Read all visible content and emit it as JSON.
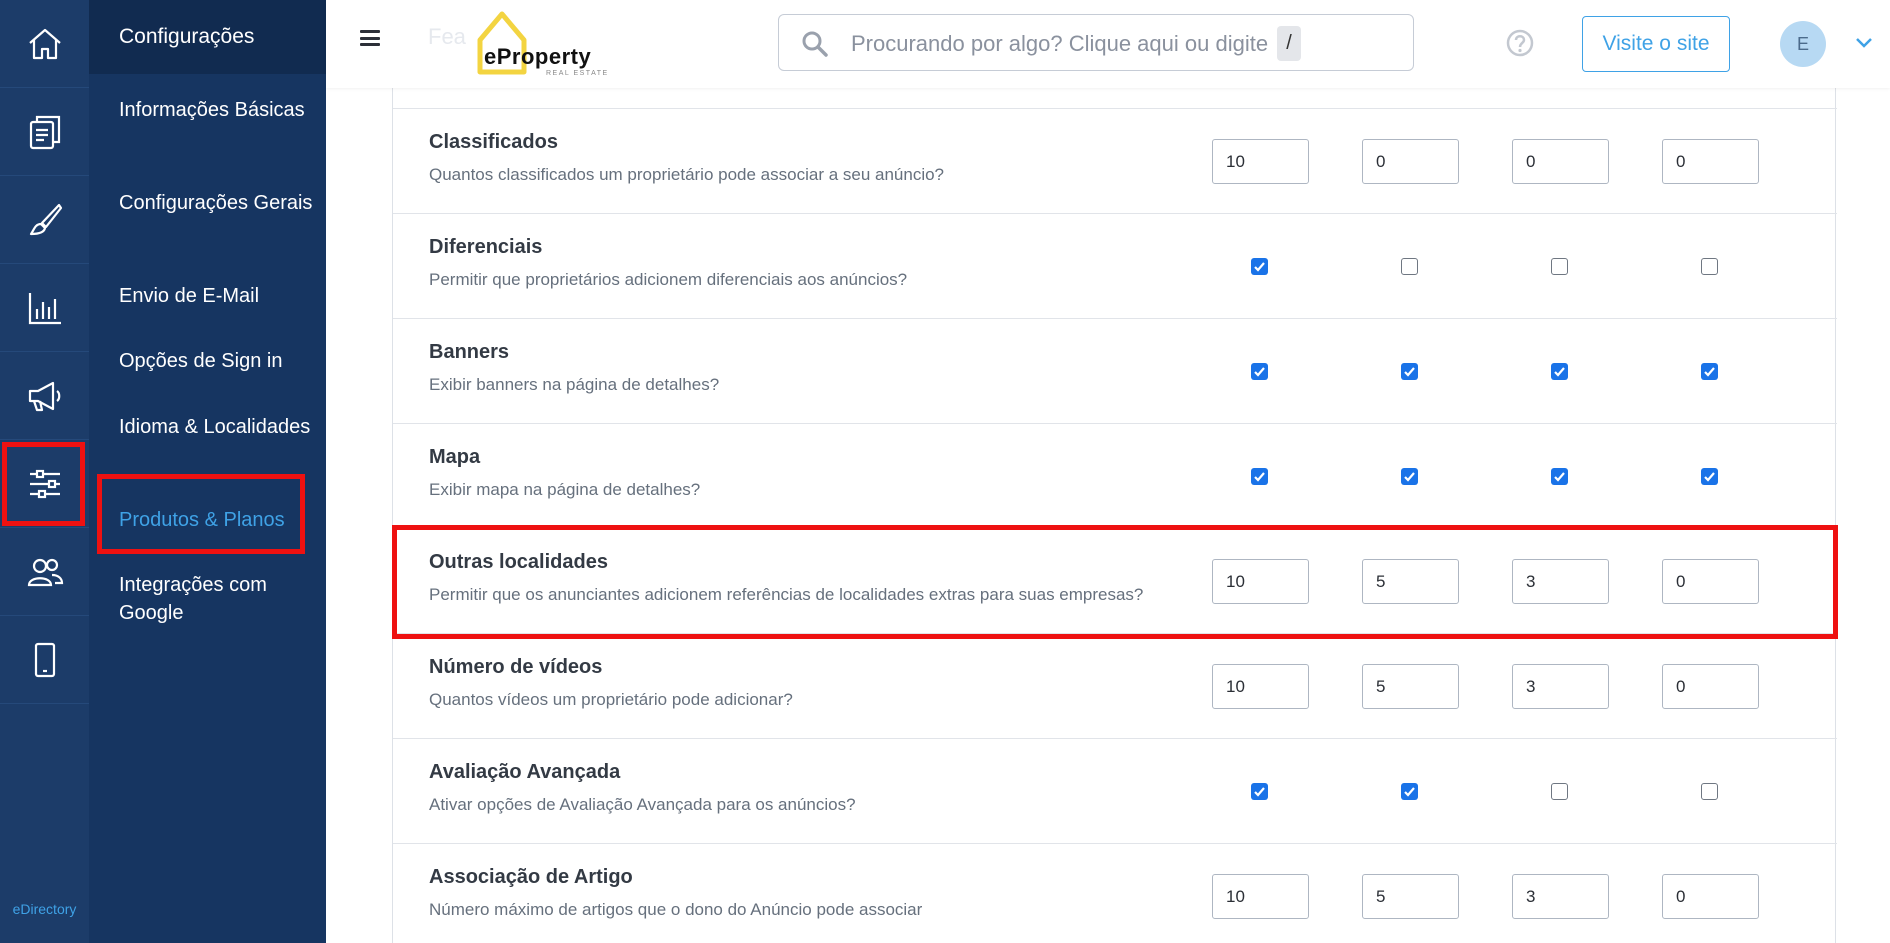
{
  "rail": {
    "items": [
      "home-icon",
      "documents-icon",
      "brush-icon",
      "bar-chart-icon",
      "megaphone-icon",
      "sliders-icon",
      "users-icon",
      "mobile-icon"
    ],
    "footer": "eDirectory"
  },
  "submenu": {
    "title": "Configurações",
    "items": [
      {
        "label": "Informações Básicas"
      },
      {
        "label": "Configurações Gerais"
      },
      {
        "label": "Envio de E-Mail"
      },
      {
        "label": "Opções de Sign in"
      },
      {
        "label": "Idioma & Localidades"
      },
      {
        "label": "Produtos & Planos"
      },
      {
        "label": "Integrações com Google"
      }
    ]
  },
  "header": {
    "ghost_title": "Fea",
    "logo_word": "eProperty",
    "logo_sub": "REAL ESTATE",
    "search_placeholder": "Procurando por algo? Clique aqui ou digite",
    "search_key": "/",
    "visit_label": "Visite o site",
    "avatar_initial": "E"
  },
  "rows": [
    {
      "title": "Classificados",
      "desc": "Quantos classificados um proprietário pode associar a seu anúncio?",
      "type": "number",
      "values": [
        "10",
        "0",
        "0",
        "0"
      ]
    },
    {
      "title": "Diferenciais",
      "desc": "Permitir que proprietários adicionem diferenciais aos anúncios?",
      "type": "check",
      "values": [
        true,
        false,
        false,
        false
      ]
    },
    {
      "title": "Banners",
      "desc": "Exibir banners na página de detalhes?",
      "type": "check",
      "values": [
        true,
        true,
        true,
        true
      ]
    },
    {
      "title": "Mapa",
      "desc": "Exibir mapa na página de detalhes?",
      "type": "check",
      "values": [
        true,
        true,
        true,
        true
      ]
    },
    {
      "title": "Outras localidades",
      "desc": "Permitir que os anunciantes adicionem referências de localidades extras para suas empresas?",
      "type": "number",
      "values": [
        "10",
        "5",
        "3",
        "0"
      ]
    },
    {
      "title": "Número de vídeos",
      "desc": "Quantos vídeos um proprietário pode adicionar?",
      "type": "number",
      "values": [
        "10",
        "5",
        "3",
        "0"
      ]
    },
    {
      "title": "Avaliação Avançada",
      "desc": "Ativar opções de Avaliação Avançada para os anúncios?",
      "type": "check",
      "values": [
        true,
        true,
        false,
        false
      ]
    },
    {
      "title": "Associação de Artigo",
      "desc": "Número máximo de artigos que o dono do Anúncio pode associar",
      "type": "number",
      "values": [
        "10",
        "5",
        "3",
        "0"
      ]
    }
  ],
  "colors": {
    "accent": "#3fa2e6",
    "checked": "#1a73e8",
    "highlight": "#ee1111",
    "rail": "#1c3c69",
    "submenu": "#163561"
  }
}
